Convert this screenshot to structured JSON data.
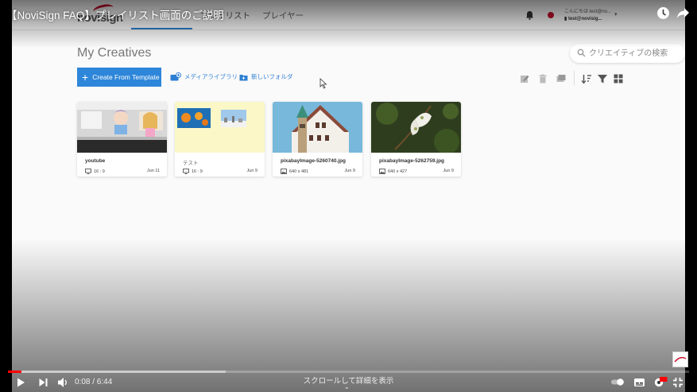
{
  "video": {
    "title": "【NoviSign FAQ】プレイリスト画面のご説明",
    "time": "0:08 / 6:44",
    "scroll_hint": "スクロールして詳細を表示",
    "progress": 0.02,
    "buffered": 0.32
  },
  "app": {
    "logo": "novisign",
    "nav": [
      {
        "label": "プレイリスト"
      },
      {
        "label": "プレイヤー"
      }
    ],
    "user": {
      "greeting": "こんにちは test@no...",
      "email": "test@novisig..."
    },
    "section_title": "My Creatives",
    "search_placeholder": "クリエイティブの検索",
    "create_button": "Create From Template",
    "media_library": "メディアライブラリ",
    "new_folder": "新しいフォルダ",
    "creatives": [
      {
        "name": "youtube",
        "meta": "16 : 9",
        "date": "Jun 11",
        "meta_icon": "monitor-icon"
      },
      {
        "name": "テスト",
        "meta": "16 : 9",
        "date": "Jun 9",
        "meta_icon": "monitor-icon"
      },
      {
        "name": "pixabayImage-5260740.jpg",
        "meta": "640 x 481",
        "date": "Jun 9",
        "meta_icon": "image-icon"
      },
      {
        "name": "pixabayImage-5262759.jpg",
        "meta": "640 x 427",
        "date": "Jun 9",
        "meta_icon": "image-icon"
      }
    ]
  },
  "colors": {
    "accent": "#2d86d9",
    "brand_red": "#c8102e",
    "yt_red": "#ff0000"
  }
}
